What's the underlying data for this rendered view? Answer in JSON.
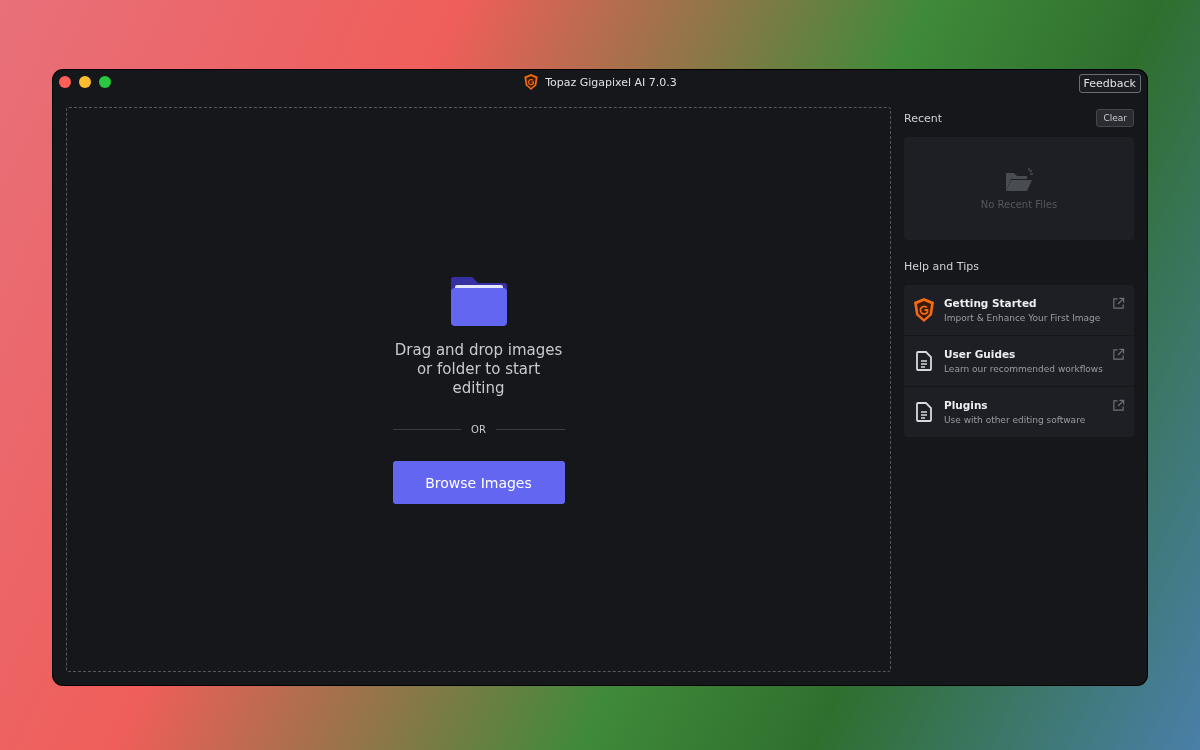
{
  "window": {
    "title": "Topaz Gigapixel AI 7.0.3",
    "feedback_button": "Feedback"
  },
  "drop_zone": {
    "message": "Drag and drop images or folder to start editing",
    "separator": "OR",
    "browse_button": "Browse Images"
  },
  "recent": {
    "heading": "Recent",
    "clear_button": "Clear",
    "empty_text": "No Recent Files"
  },
  "help": {
    "heading": "Help and Tips",
    "items": [
      {
        "kind": "logo",
        "title": "Getting Started",
        "subtitle": "Import & Enhance Your First Image"
      },
      {
        "kind": "document",
        "title": "User Guides",
        "subtitle": "Learn our recommended workflows"
      },
      {
        "kind": "document",
        "title": "Plugins",
        "subtitle": "Use with other editing software"
      }
    ]
  }
}
